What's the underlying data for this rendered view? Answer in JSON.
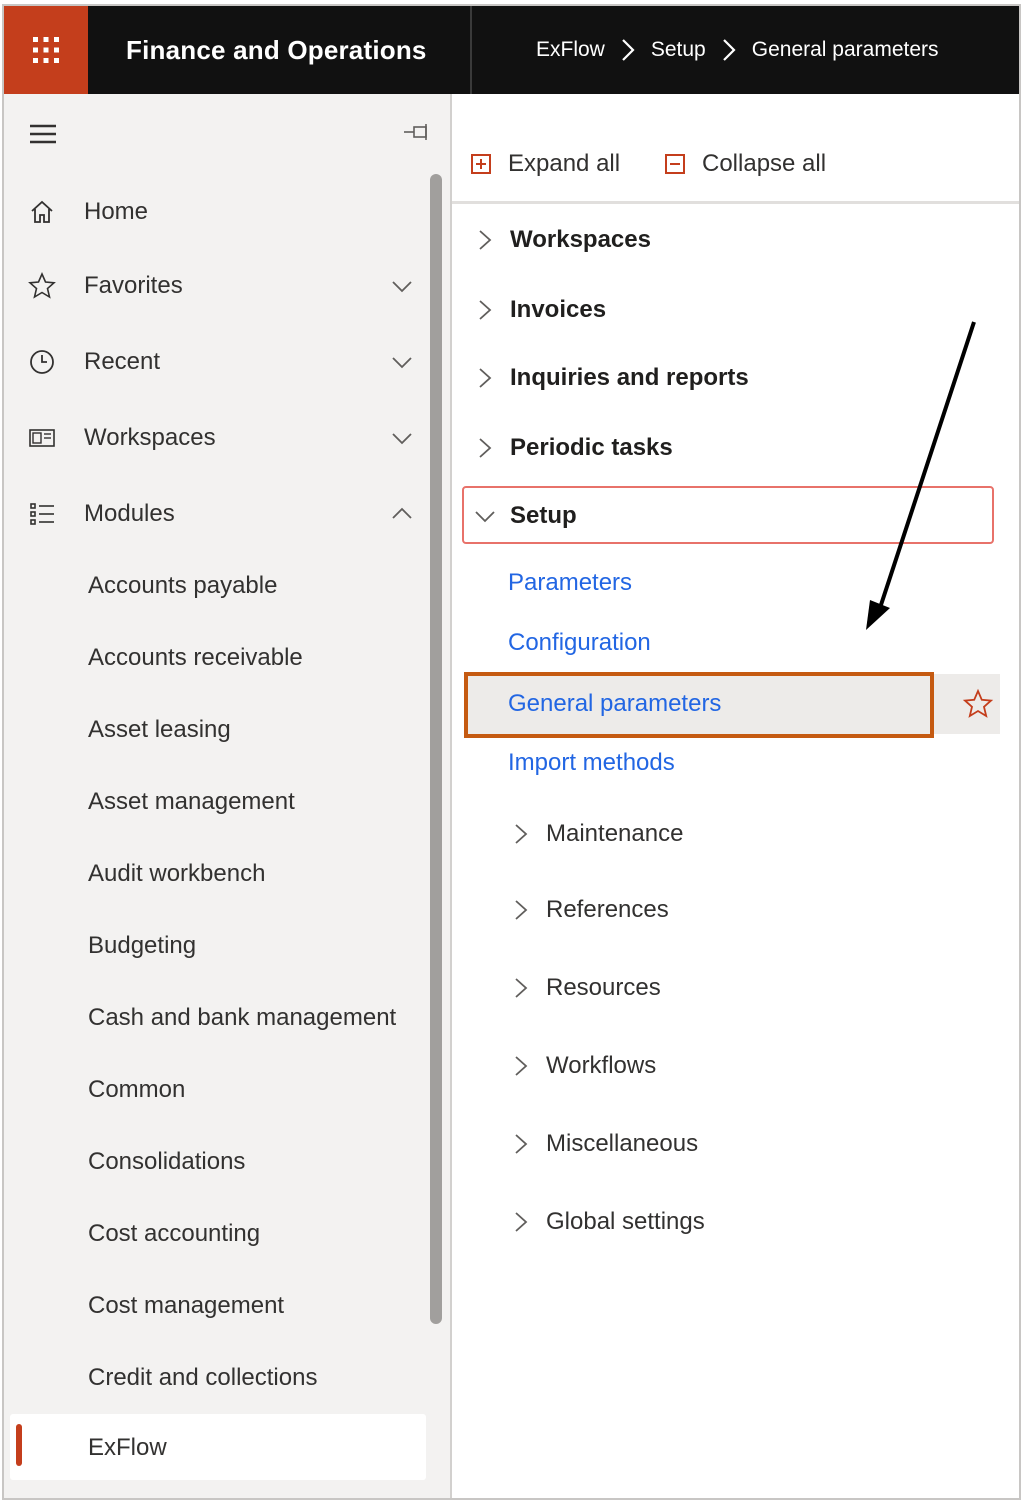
{
  "topbar": {
    "app_title": "Finance and Operations",
    "breadcrumb": [
      "ExFlow",
      "Setup",
      "General parameters"
    ],
    "accent_color": "#c43e1c"
  },
  "leftnav": {
    "items": [
      {
        "label": "Home",
        "icon": "home-icon"
      },
      {
        "label": "Favorites",
        "icon": "star-icon",
        "expanded": false
      },
      {
        "label": "Recent",
        "icon": "clock-icon",
        "expanded": false
      },
      {
        "label": "Workspaces",
        "icon": "workspace-icon",
        "expanded": false
      },
      {
        "label": "Modules",
        "icon": "modules-list-icon",
        "expanded": true
      }
    ],
    "modules": [
      "Accounts payable",
      "Accounts receivable",
      "Asset leasing",
      "Asset management",
      "Audit workbench",
      "Budgeting",
      "Cash and bank management",
      "Common",
      "Consolidations",
      "Cost accounting",
      "Cost management",
      "Credit and collections",
      "ExFlow"
    ],
    "selected_module": "ExFlow"
  },
  "content": {
    "toolbar": {
      "expand_all": "Expand all",
      "collapse_all": "Collapse all"
    },
    "groups": [
      "Workspaces",
      "Invoices",
      "Inquiries and reports",
      "Periodic tasks",
      "Setup"
    ],
    "setup_links": [
      "Parameters",
      "Configuration",
      "General parameters",
      "Import methods"
    ],
    "setup_subgroups": [
      "Maintenance",
      "References",
      "Resources",
      "Workflows",
      "Miscellaneous",
      "Global settings"
    ],
    "highlighted_link": "General parameters",
    "link_color": "#2266e3",
    "highlight_color": "#c55a11"
  }
}
